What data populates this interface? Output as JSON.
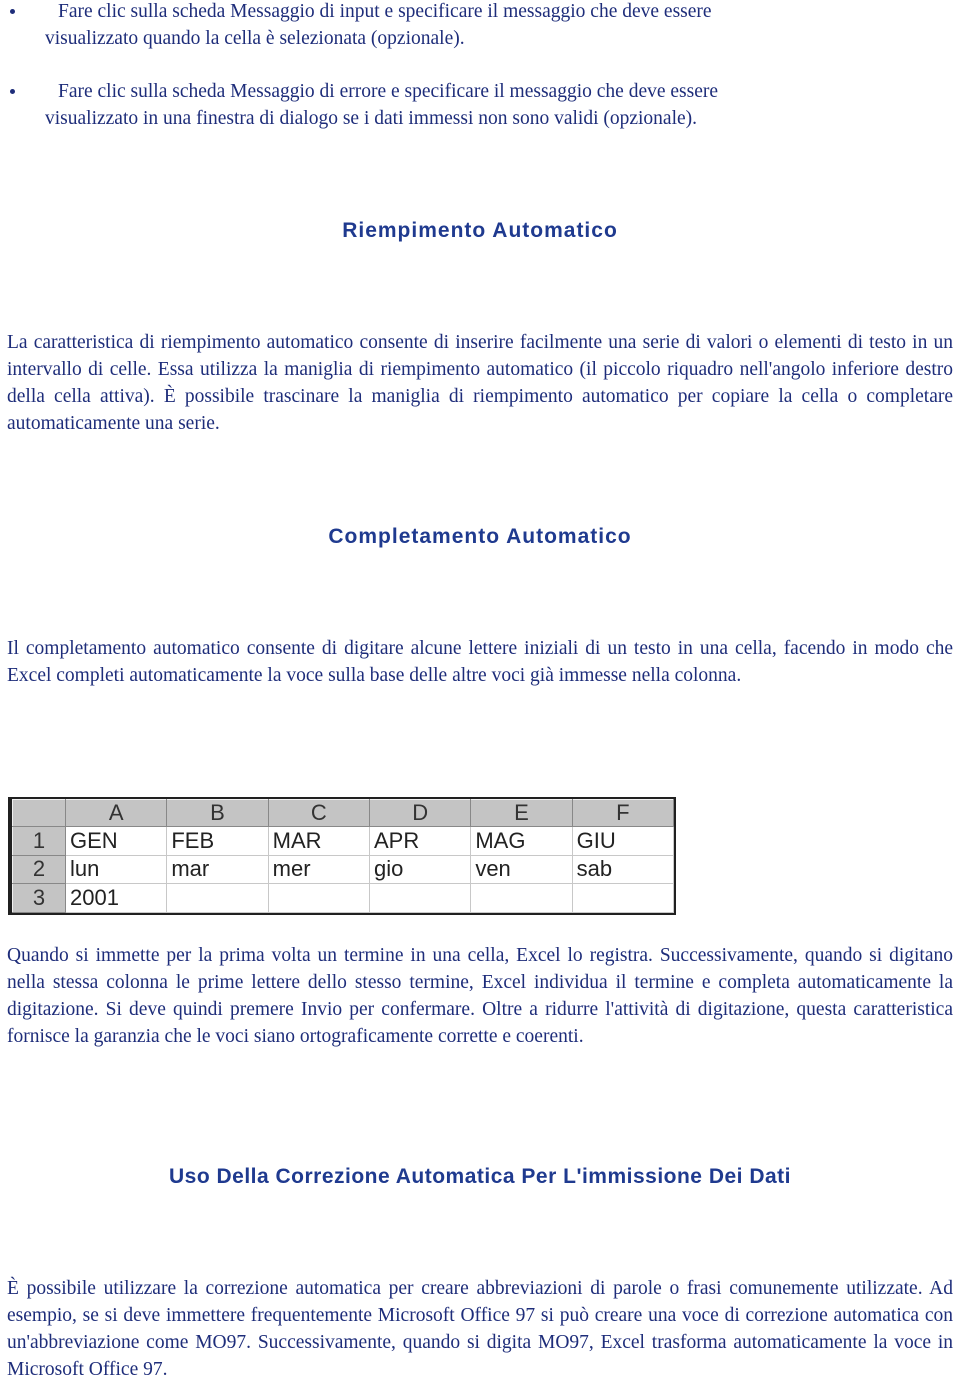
{
  "bullets": [
    {
      "first": "Fare clic sulla scheda Messaggio di input e specificare il messaggio che deve essere",
      "rest": "visualizzato quando la cella è selezionata (opzionale)."
    },
    {
      "first": "Fare clic sulla scheda Messaggio di errore e specificare il messaggio che deve essere",
      "rest": "visualizzato in una finestra di dialogo se i dati immessi non sono validi (opzionale)."
    }
  ],
  "sections": [
    {
      "heading": "Riempimento Automatico",
      "paragraphs": [
        "La caratteristica di riempimento automatico consente di inserire facilmente una serie di valori o elementi di testo in un intervallo di celle. Essa utilizza la maniglia di riempimento automatico (il piccolo riquadro nell'angolo inferiore destro della cella attiva). È possibile trascinare la maniglia di riempimento automatico per copiare la cella o completare automaticamente una serie."
      ]
    },
    {
      "heading": "Completamento Automatico",
      "paragraphs": [
        "Il completamento automatico consente di digitare alcune lettere iniziali di un testo in una cella, facendo in modo che Excel completi automaticamente la voce sulla base delle altre voci già immesse nella colonna.",
        "Quando si immette per la prima volta un termine in una cella, Excel lo registra. Successivamente, quando si digitano nella stessa colonna le prime lettere dello stesso termine, Excel individua il termine e completa automaticamente la digitazione. Si deve quindi premere Invio per confermare. Oltre a ridurre l'attività di digitazione, questa caratteristica fornisce la garanzia che le voci siano ortograficamente corrette e coerenti."
      ]
    },
    {
      "heading": "Uso Della Correzione Automatica Per L'immissione Dei Dati",
      "paragraphs": [
        "È possibile utilizzare la correzione automatica per creare abbreviazioni di parole o frasi comunemente utilizzate. Ad esempio, se si deve immettere frequentemente Microsoft Office 97 si può creare una voce di correzione automatica con un'abbreviazione come MO97. Successivamente, quando si digita MO97, Excel trasforma automaticamente la voce in Microsoft Office 97."
      ]
    }
  ],
  "spreadsheet": {
    "columns": [
      "A",
      "B",
      "C",
      "D",
      "E",
      "F"
    ],
    "rows": [
      {
        "num": "1",
        "cells": [
          "GEN",
          "FEB",
          "MAR",
          "APR",
          "MAG",
          "GIU"
        ]
      },
      {
        "num": "2",
        "cells": [
          "lun",
          "mar",
          "mer",
          "gio",
          "ven",
          "sab"
        ]
      },
      {
        "num": "3",
        "cells": [
          "2001",
          "",
          "",
          "",
          "",
          ""
        ]
      }
    ]
  }
}
